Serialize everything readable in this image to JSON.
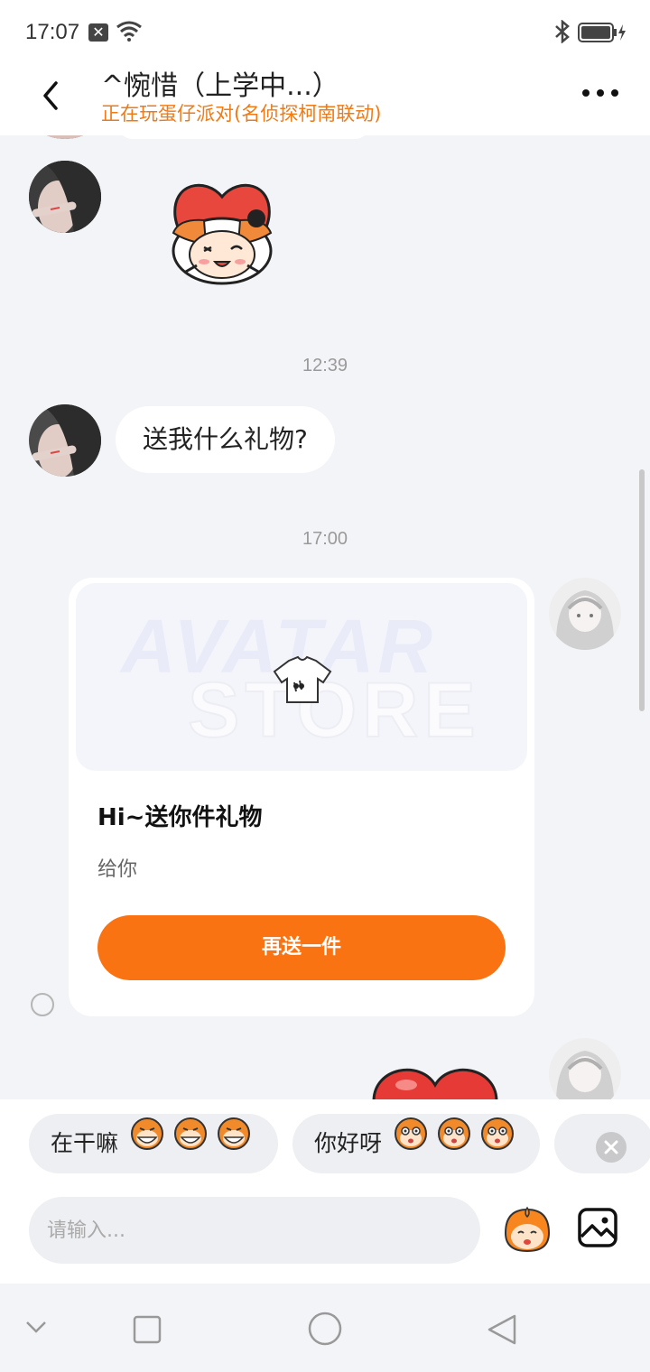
{
  "status_bar": {
    "time": "17:07",
    "notification_glyph": "✕",
    "icons": [
      "wifi-icon",
      "bluetooth-icon",
      "battery-charging-icon"
    ]
  },
  "header": {
    "title": "^惋惜（上学中...）",
    "subtitle": "正在玩蛋仔派对(名侦探柯南联动)",
    "back_icon": "chevron-left-icon",
    "more_icon": "more-dots-icon"
  },
  "messages": [
    {
      "type": "sticker",
      "side": "left",
      "sticker": "heart-hat-character-sticker"
    },
    {
      "type": "timestamp",
      "text": "12:39"
    },
    {
      "type": "text",
      "side": "left",
      "text": "送我什么礼物?"
    },
    {
      "type": "timestamp",
      "text": "17:00"
    },
    {
      "type": "gift_card",
      "side": "right",
      "watermark_line1": "AVATAR",
      "watermark_line2": "STORE",
      "gift_icon": "tshirt-icon",
      "title": "Hi~送你件礼物",
      "desc": "给你",
      "button": "再送一件"
    },
    {
      "type": "sticker",
      "side": "right",
      "sticker": "red-heart-sticker"
    }
  ],
  "quick_replies": [
    {
      "text": "在干嘛",
      "emoji": "grinning-monkey-emoji"
    },
    {
      "text": "你好呀",
      "emoji": "surprised-monkey-emoji"
    }
  ],
  "input": {
    "placeholder": "请输入..."
  },
  "colors": {
    "accent": "#f97312",
    "subtitle": "#f07a15",
    "background": "#f3f4f7",
    "bubble": "#ffffff"
  },
  "nav_bar": {
    "icons": [
      "chevron-down-icon",
      "square-icon",
      "circle-icon",
      "triangle-back-icon"
    ]
  }
}
